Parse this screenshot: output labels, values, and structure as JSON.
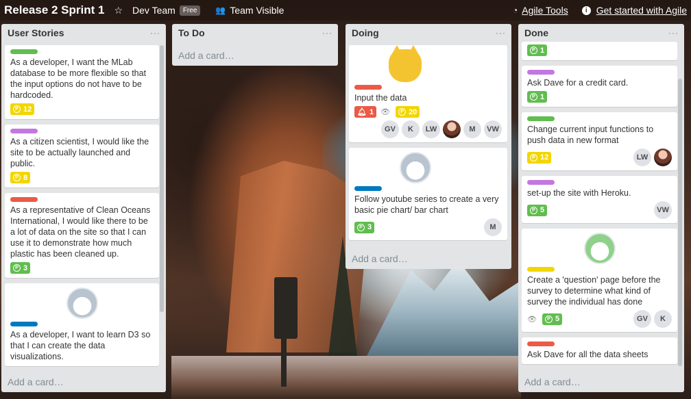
{
  "header": {
    "board_title": "Release 2 Sprint 1",
    "team_name": "Dev Team",
    "team_badge": "Free",
    "visibility": "Team Visible",
    "agile_tools": "Agile Tools",
    "get_started": "Get started with Agile"
  },
  "lists": [
    {
      "title": "User Stories",
      "menu": "···",
      "add_card": "Add a card…",
      "cards": [
        {
          "label_color": "#61bd4f",
          "text": "As a developer, I want the MLab database to be more flexible so that the input options do not have to be hardcoded.",
          "points": "12",
          "points_color": "yellow"
        },
        {
          "label_color": "#c377e0",
          "text": "As a citizen scientist, I would like the site to be actually launched and public.",
          "points": "8",
          "points_color": "yellow"
        },
        {
          "label_color": "#eb5a46",
          "text": "As a representative of Clean Oceans International, I would like there to be a lot of data on the site so that I can use it to demonstrate how much plastic has been cleaned up.",
          "points": "3",
          "points_color": "green"
        },
        {
          "sticker": "husky-sticker",
          "label_color": "#0079bf",
          "text": "As a developer, I want to learn D3 so that I can create the data visualizations."
        }
      ]
    },
    {
      "title": "To Do",
      "menu": "···",
      "add_card": "Add a card…",
      "cards": []
    },
    {
      "title": "Doing",
      "menu": "···",
      "add_card": "Add a card…",
      "cards": [
        {
          "sticker": "fox-sticker",
          "label_color": "#eb5a46",
          "text": "Input the data",
          "notifications": "1",
          "points": "20",
          "points_color": "yellow",
          "members": [
            "GV",
            "K",
            "LW",
            "photo",
            "M",
            "VW"
          ]
        },
        {
          "sticker": "husky-sticker",
          "label_color": "#0079bf",
          "text": "Follow youtube series to create a very basic pie chart/ bar chart",
          "points": "3",
          "points_color": "green",
          "members": [
            "M"
          ]
        }
      ]
    },
    {
      "title": "Done",
      "menu": "···",
      "add_card": "Add a card…",
      "cards": [
        {
          "points": "1",
          "points_color": "green"
        },
        {
          "label_color": "#c377e0",
          "text": "Ask Dave for a credit card.",
          "points": "1",
          "points_color": "green"
        },
        {
          "label_color": "#61bd4f",
          "text": "Change current input functions to push data in new format",
          "points": "12",
          "points_color": "yellow",
          "members": [
            "LW",
            "photo"
          ]
        },
        {
          "label_color": "#c377e0",
          "text": "set-up the site with Heroku.",
          "points": "5",
          "points_color": "green",
          "members": [
            "VW"
          ]
        },
        {
          "sticker": "money-husky-sticker",
          "label_color": "#f2d600",
          "text": "Create a 'question' page before the survey to determine what kind of survey the individual has done",
          "points": "5",
          "points_color": "green",
          "watch": true,
          "members": [
            "GV",
            "K"
          ]
        },
        {
          "label_color": "#eb5a46",
          "text": "Ask Dave for all the data sheets"
        }
      ]
    }
  ]
}
